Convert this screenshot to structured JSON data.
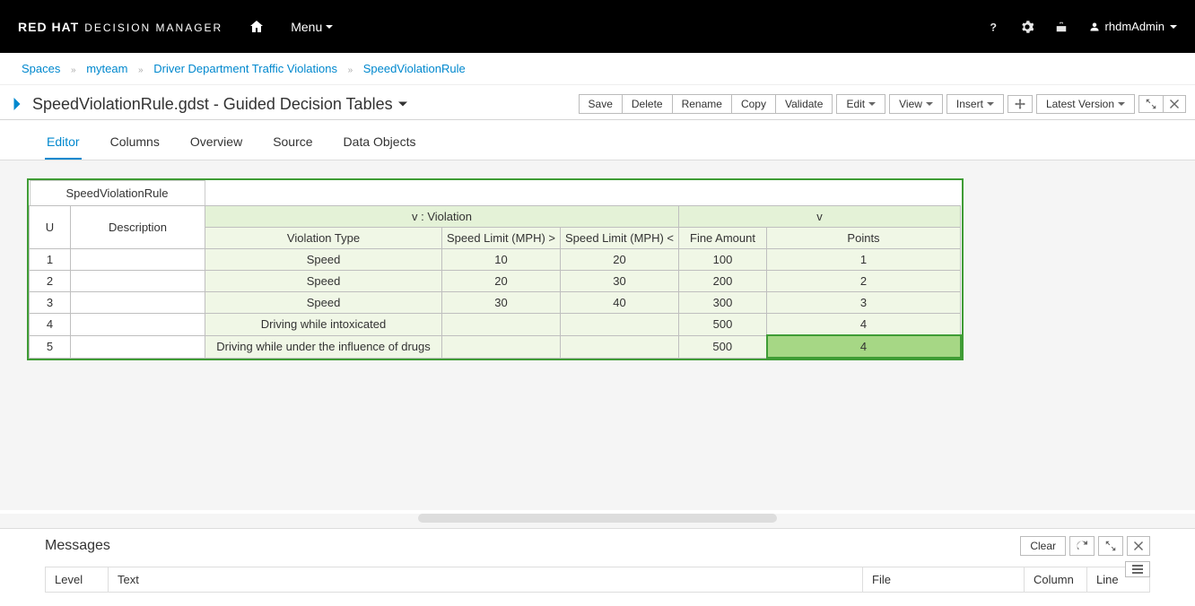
{
  "header": {
    "brand_bold": "RED HAT",
    "brand_rest": "DECISION MANAGER",
    "menu_label": "Menu",
    "user": "rhdmAdmin"
  },
  "breadcrumbs": {
    "items": [
      "Spaces",
      "myteam",
      "Driver Department Traffic Violations",
      "SpeedViolationRule"
    ]
  },
  "page": {
    "title": "SpeedViolationRule.gdst - Guided Decision Tables"
  },
  "toolbar": {
    "save": "Save",
    "delete": "Delete",
    "rename": "Rename",
    "copy": "Copy",
    "validate": "Validate",
    "edit": "Edit",
    "view": "View",
    "insert": "Insert",
    "latest_version": "Latest Version"
  },
  "tabs": [
    "Editor",
    "Columns",
    "Overview",
    "Source",
    "Data Objects"
  ],
  "decision_table": {
    "name": "SpeedViolationRule",
    "col_u": "U",
    "col_desc": "Description",
    "group_violation": "v : Violation",
    "group_v": "v",
    "col_vtype": "Violation Type",
    "col_slmin": "Speed Limit (MPH) >",
    "col_slmax": "Speed Limit (MPH) <",
    "col_fine": "Fine Amount",
    "col_points": "Points",
    "rows": [
      {
        "n": "1",
        "desc": "",
        "vtype": "Speed",
        "slmin": "10",
        "slmax": "20",
        "fine": "100",
        "pts": "1"
      },
      {
        "n": "2",
        "desc": "",
        "vtype": "Speed",
        "slmin": "20",
        "slmax": "30",
        "fine": "200",
        "pts": "2"
      },
      {
        "n": "3",
        "desc": "",
        "vtype": "Speed",
        "slmin": "30",
        "slmax": "40",
        "fine": "300",
        "pts": "3"
      },
      {
        "n": "4",
        "desc": "",
        "vtype": "Driving while intoxicated",
        "slmin": "",
        "slmax": "",
        "fine": "500",
        "pts": "4"
      },
      {
        "n": "5",
        "desc": "",
        "vtype": "Driving while under the influence of drugs",
        "slmin": "",
        "slmax": "",
        "fine": "500",
        "pts": "4"
      }
    ]
  },
  "messages": {
    "title": "Messages",
    "clear": "Clear",
    "cols": {
      "level": "Level",
      "text": "Text",
      "file": "File",
      "column": "Column",
      "line": "Line"
    }
  }
}
